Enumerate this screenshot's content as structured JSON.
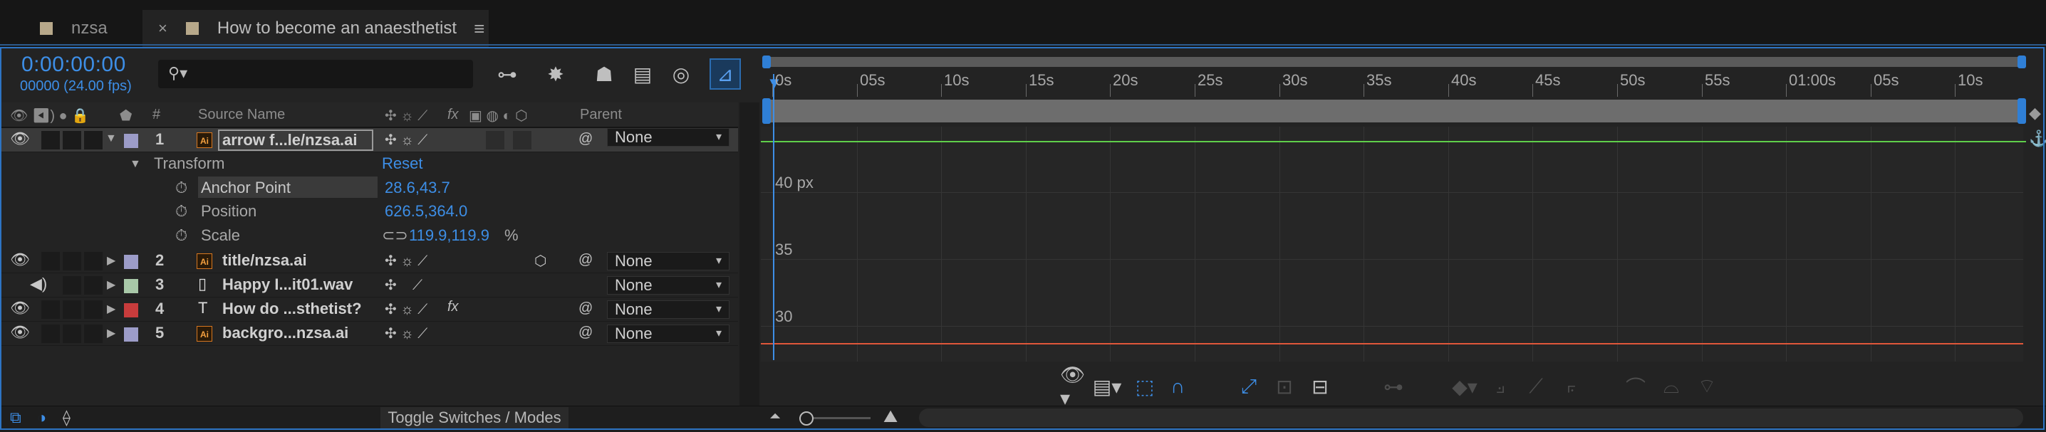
{
  "tabs": [
    {
      "label": "nzsa",
      "swatch": "#b7a88a"
    },
    {
      "label": "How to become an anaesthetist",
      "swatch": "#b7a88a",
      "active": true
    }
  ],
  "header": {
    "timecode": "0:00:00:00",
    "frames": "00000 (24.00 fps)",
    "search_icon": "search-icon"
  },
  "columns": {
    "number": "#",
    "source_name": "Source Name",
    "parent": "Parent",
    "fx": "fx"
  },
  "layers": [
    {
      "num": "1",
      "name": "arrow f...le/nzsa.ai",
      "color": "#9c9cc8",
      "type": "ai",
      "parent": "None",
      "selected": true,
      "expanded": true
    },
    {
      "num": "2",
      "name": "title/nzsa.ai",
      "color": "#9c9cc8",
      "type": "ai",
      "parent": "None"
    },
    {
      "num": "3",
      "name": "Happy I...it01.wav",
      "color": "#a8c8a8",
      "type": "audio",
      "parent": "None"
    },
    {
      "num": "4",
      "name": "How do ...sthetist?",
      "color": "#c83c3c",
      "type": "text",
      "parent": "None"
    },
    {
      "num": "5",
      "name": "backgro...nzsa.ai",
      "color": "#9c9cc8",
      "type": "ai",
      "parent": "None"
    }
  ],
  "transform": {
    "label": "Transform",
    "reset": "Reset",
    "anchor_label": "Anchor Point",
    "anchor_value": "28.6,43.7",
    "position_label": "Position",
    "position_value": "626.5,364.0",
    "scale_label": "Scale",
    "scale_value": "119.9,119.9",
    "scale_unit": "%"
  },
  "ruler": {
    "labels": [
      "0s",
      "05s",
      "10s",
      "15s",
      "20s",
      "25s",
      "30s",
      "35s",
      "40s",
      "45s",
      "50s",
      "55s",
      "01:00s",
      "05s",
      "10s"
    ]
  },
  "graph": {
    "px_label": "40 px",
    "y_labels": [
      "35",
      "30"
    ]
  },
  "bottom": {
    "toggle_label": "Toggle Switches / Modes"
  }
}
